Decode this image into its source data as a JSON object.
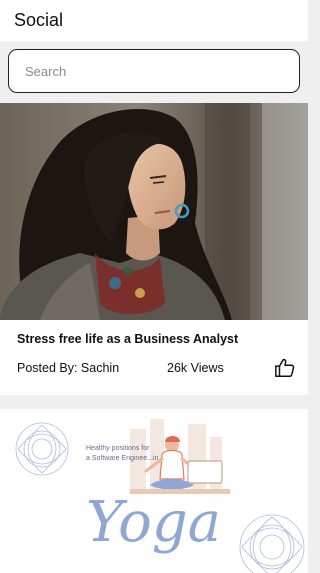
{
  "header": {
    "title": "Social"
  },
  "search": {
    "placeholder": "Search",
    "value": ""
  },
  "posts": [
    {
      "title": "Stress free life as a Business Analyst",
      "posted_by": "Posted By: Sachin",
      "views": "26k Views"
    },
    {
      "image_caption": "Healthy positions for a Software Enginee...in",
      "image_word": "Yoga"
    }
  ],
  "colors": {
    "accent_blue": "#8ea6d8",
    "background": "#efefef"
  }
}
